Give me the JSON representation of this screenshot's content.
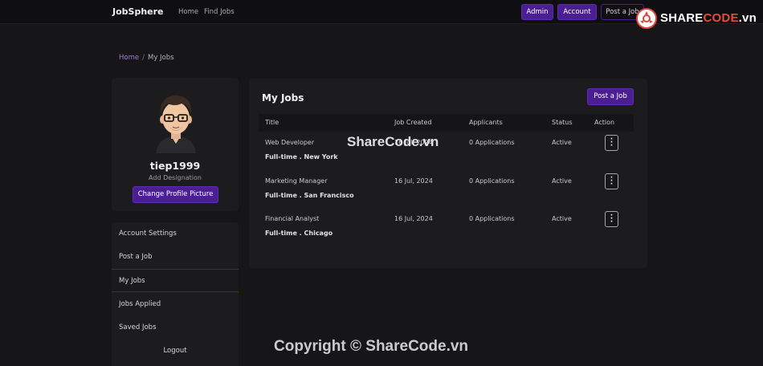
{
  "navbar": {
    "brand": "JobSphere",
    "links": [
      "Home",
      "Find Jobs"
    ],
    "admin_label": "Admin",
    "account_label": "Account",
    "post_job_label": "Post a Job"
  },
  "watermark": {
    "logo_text_a": "SHARE",
    "logo_text_b": "CODE",
    "logo_text_c": ".vn",
    "center_text": "ShareCode.vn",
    "copyright_text": "Copyright © ShareCode.vn"
  },
  "breadcrumb": {
    "home": "Home",
    "separator": "/",
    "current": "My Jobs"
  },
  "profile": {
    "username": "tiep1999",
    "designation": "Add Designation",
    "change_picture_label": "Change Profile Picture"
  },
  "menu": {
    "items": [
      "Account Settings",
      "Post a Job",
      "My Jobs",
      "Jobs Applied",
      "Saved Jobs"
    ],
    "logout_label": "Logout",
    "active_item": "My Jobs"
  },
  "main": {
    "title": "My Jobs",
    "post_job_label": "Post a Job",
    "columns": [
      "Title",
      "Job Created",
      "Applicants",
      "Status",
      "Action"
    ],
    "rows": [
      {
        "title": "Web Developer",
        "meta": "Full-time . New York",
        "created": "16 Jul, 2024",
        "applicants": "0 Applications",
        "status": "Active"
      },
      {
        "title": "Marketing Manager",
        "meta": "Full-time . San Francisco",
        "created": "16 Jul, 2024",
        "applicants": "0 Applications",
        "status": "Active"
      },
      {
        "title": "Financial Analyst",
        "meta": "Full-time . Chicago",
        "created": "16 Jul, 2024",
        "applicants": "0 Applications",
        "status": "Active"
      }
    ]
  },
  "colors": {
    "background": "#161618",
    "card": "#1c1c1f",
    "accent": "#4b1e93",
    "link": "#9b7bd8"
  }
}
